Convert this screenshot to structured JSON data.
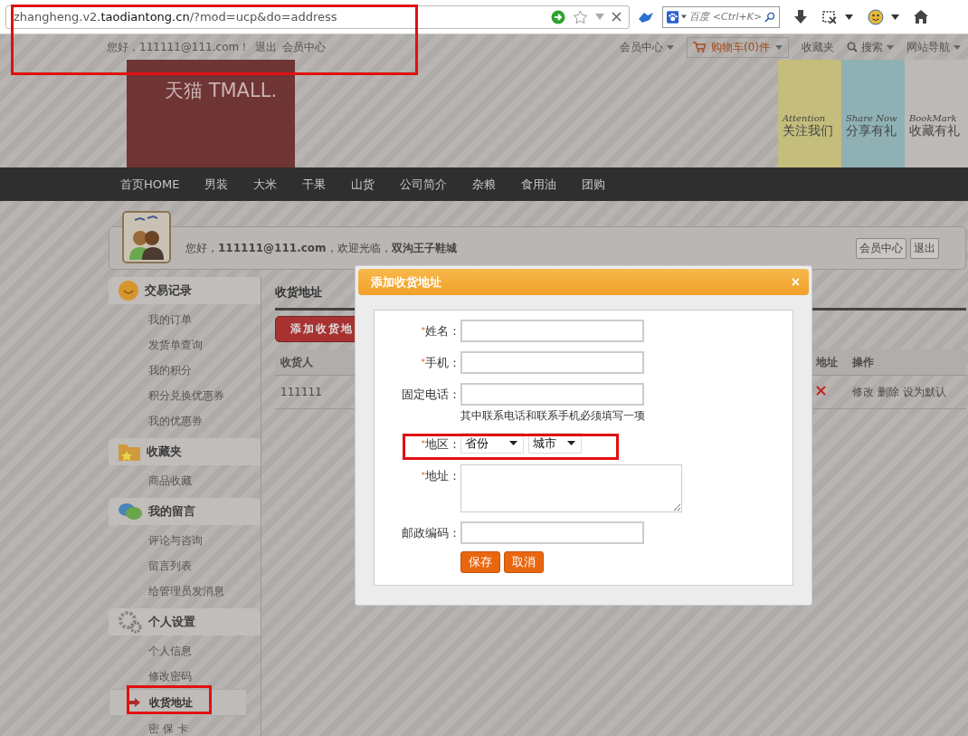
{
  "browser": {
    "url": "zhangheng.v2.**taodiantong.cn**/?mod=ucp&do=address",
    "search_placeholder": "百度 <Ctrl+K>"
  },
  "top_bar": {
    "greeting": "您好，111111@111.com！",
    "links": [
      "退出",
      "会员中心"
    ],
    "menu": [
      {
        "label": "会员中心",
        "kind": "dropdown"
      },
      {
        "label": "购物车(0)件",
        "kind": "cart"
      },
      {
        "label": "收藏夹",
        "kind": "plain"
      },
      {
        "label": "搜索",
        "kind": "search"
      },
      {
        "label": "网站导航",
        "kind": "dropdown"
      }
    ]
  },
  "header": {
    "logo": "天猫 TMALL.",
    "promos": [
      {
        "en": "Attention",
        "zh": "关注我们",
        "color": "#c4bd7c"
      },
      {
        "en": "Share Now",
        "zh": "分享有礼",
        "color": "#8fb1b3"
      },
      {
        "en": "BookMark",
        "zh": "收藏有礼",
        "color": "#bcb9b6"
      }
    ]
  },
  "nav": [
    "首页HOME",
    "男装",
    "大米",
    "干果",
    "山货",
    "公司简介",
    "杂粮",
    "食用油",
    "团购"
  ],
  "user_card": {
    "greeting": "您好，**111111@111.com**，欢迎光临，**双沟王子鞋城**",
    "buttons": [
      "会员中心",
      "退出"
    ]
  },
  "sidebar": [
    {
      "title": "交易记录",
      "kind": "smiley",
      "items": [
        {
          "label": "我的订单",
          "selected": false
        },
        {
          "label": "发货单查询",
          "selected": false
        },
        {
          "label": "我的积分",
          "selected": false
        },
        {
          "label": "积分兑换优惠券",
          "selected": false
        },
        {
          "label": "我的优惠券",
          "selected": false
        }
      ]
    },
    {
      "title": "收藏夹",
      "kind": "folder",
      "items": [
        {
          "label": "商品收藏",
          "selected": false
        }
      ]
    },
    {
      "title": "我的留言",
      "kind": "chat",
      "items": [
        {
          "label": "评论与咨询",
          "selected": false
        },
        {
          "label": "留言列表",
          "selected": false
        },
        {
          "label": "给管理员发消息",
          "selected": false
        }
      ]
    },
    {
      "title": "个人设置",
      "kind": "gears",
      "items": [
        {
          "label": "个人信息",
          "selected": false
        },
        {
          "label": "修改密码",
          "selected": false
        },
        {
          "label": "收货地址",
          "selected": true
        },
        {
          "label": "密 保 卡",
          "selected": false
        }
      ]
    }
  ],
  "content": {
    "title": "收货地址",
    "add_button": "添加收货地",
    "table": {
      "columns": [
        "收货人",
        "地址",
        "操作"
      ],
      "rows": [
        {
          "name": "111111",
          "actions": [
            "修改",
            "删除",
            "设为默认"
          ]
        }
      ]
    }
  },
  "dialog": {
    "title": "添加收货地址",
    "close": "×",
    "fields": [
      {
        "mark": "*",
        "label": "姓名：",
        "kind": "input"
      },
      {
        "mark": "*",
        "label": "手机：",
        "kind": "input"
      },
      {
        "label": "固定电话：",
        "kind": "input",
        "hint": "其中联系电话和联系手机必须填写一项"
      },
      {
        "mark": "*",
        "label": "地区：",
        "kind": "selects",
        "options": [
          "省份",
          "城市"
        ]
      },
      {
        "mark": "*",
        "label": "地址：",
        "kind": "textarea"
      },
      {
        "label": "邮政编码：",
        "kind": "input"
      }
    ],
    "buttons": [
      "保存",
      "取消"
    ]
  }
}
